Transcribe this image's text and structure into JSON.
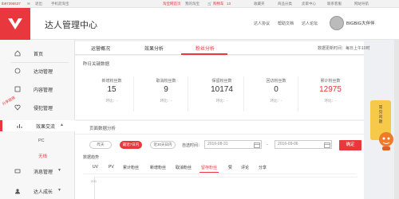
{
  "topbar": {
    "user_id": "tb97395537",
    "msg_icon": "mail-icon",
    "exit_label": "退出",
    "mobile_label": "手机逛淘宝",
    "links": [
      "淘宝网首页",
      "我的淘宝",
      "购物车",
      "收藏夹",
      "商品分类",
      "卖家中心",
      "联系客服",
      "网站导航"
    ],
    "cart_count": "13"
  },
  "header": {
    "title": "达人管理中心",
    "links": [
      "达人协议",
      "帮助文档",
      "达人论坛"
    ],
    "username": "BIGBIG大伴伴"
  },
  "sidebar": {
    "items": [
      {
        "label": "首页",
        "icon": "home-icon"
      },
      {
        "label": "达动管理",
        "icon": "activity-icon"
      },
      {
        "label": "内容管理",
        "icon": "content-icon"
      },
      {
        "label": "侵犯管理",
        "icon": "heart-icon"
      },
      {
        "label": "效果交流",
        "icon": "chart-icon"
      },
      {
        "label": "消息管理",
        "icon": "message-icon"
      },
      {
        "label": "达人成长",
        "icon": "user-icon"
      }
    ],
    "sub_items": [
      "PC",
      "无线"
    ]
  },
  "side_tags": [
    "分享链接",
    "分享链接"
  ],
  "tabs": [
    "运营概况",
    "效果分析",
    "粉丝分析"
  ],
  "update_time": "数据更新时间：每日上午10时",
  "stats": {
    "section_title": "昨日关键数据",
    "metrics": [
      {
        "label": "新增粉丝数",
        "value": "15",
        "compare": "环比：-"
      },
      {
        "label": "取消粉丝数",
        "value": "9",
        "compare": "环比：-"
      },
      {
        "label": "保留粉丝数",
        "value": "10174",
        "compare": "环比：-"
      },
      {
        "label": "回访粉丝数",
        "value": "0",
        "compare": "环比：-"
      },
      {
        "label": "累计粉丝数",
        "value": "12975",
        "compare": "环比：-"
      }
    ]
  },
  "trend": {
    "section_title": "页面数据分析",
    "range_pills": [
      "昨天",
      "最近7日内",
      "近30天日内"
    ],
    "custom_label": "自选时间：",
    "date_start": "2016-08-31",
    "date_end": "2016-09-06",
    "date_sep": "-",
    "confirm_label": "确定",
    "sub_title": "数据趋势",
    "metric_tabs": [
      "UV",
      "PV",
      "累计粉丝",
      "新增粉丝",
      "取消粉丝",
      "留存粉丝",
      "赞",
      "评论",
      "分享"
    ],
    "chart_ytick": "200"
  },
  "right_widget": {
    "line1": "常",
    "line2": "见",
    "line3": "问",
    "line4": "题"
  },
  "colors": {
    "accent": "#e8383d",
    "widget": "#f7c948"
  }
}
